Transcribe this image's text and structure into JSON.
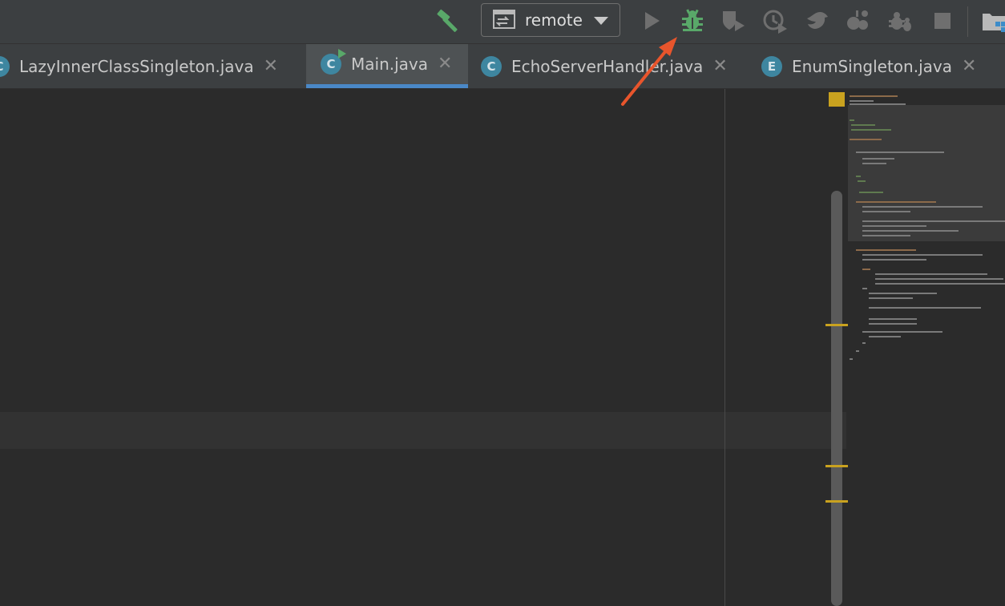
{
  "toolbar": {
    "run_config": {
      "label": "remote"
    },
    "buttons": [
      {
        "name": "build-button",
        "icon": "hammer-icon",
        "color": "#59a869"
      },
      {
        "name": "run-button",
        "icon": "play-icon",
        "color": "#6f6f6f"
      },
      {
        "name": "debug-button",
        "icon": "bug-icon",
        "color": "#59a869"
      },
      {
        "name": "run-with-coverage-button",
        "icon": "coverage-icon",
        "color": "#6f6f6f"
      },
      {
        "name": "profile-button",
        "icon": "profiler-icon",
        "color": "#6f6f6f"
      },
      {
        "name": "concurrency-button",
        "icon": "bird-icon",
        "color": "#6f6f6f"
      },
      {
        "name": "attach-debugger-button",
        "icon": "attach-icon",
        "color": "#6f6f6f"
      },
      {
        "name": "stop-bug-button",
        "icon": "bug-alt-icon",
        "color": "#6f6f6f"
      },
      {
        "name": "stop-button",
        "icon": "stop-icon",
        "color": "#6f6f6f"
      },
      {
        "name": "project-structure-button",
        "icon": "folder-icon",
        "color": "#b9b9b9"
      }
    ]
  },
  "tabs": [
    {
      "label": "LazyInnerClassSingleton.java",
      "icon_letter": "C",
      "icon": "class-icon",
      "active": false
    },
    {
      "label": "Main.java",
      "icon_letter": "C",
      "icon": "runnable-class-icon",
      "active": true
    },
    {
      "label": "EchoServerHandler.java",
      "icon_letter": "C",
      "icon": "class-icon",
      "active": false
    },
    {
      "label": "EnumSingleton.java",
      "icon_letter": "E",
      "icon": "enum-icon",
      "active": false
    }
  ],
  "tab_close_glyph": "✕",
  "colors": {
    "accent": "#4a88c7",
    "debug_green": "#59a869",
    "annotation_arrow": "#e8552c",
    "warning_stripe": "#c9a21f"
  },
  "annotation": {
    "icon": "arrow-pointer",
    "points_to": "debug-button"
  }
}
